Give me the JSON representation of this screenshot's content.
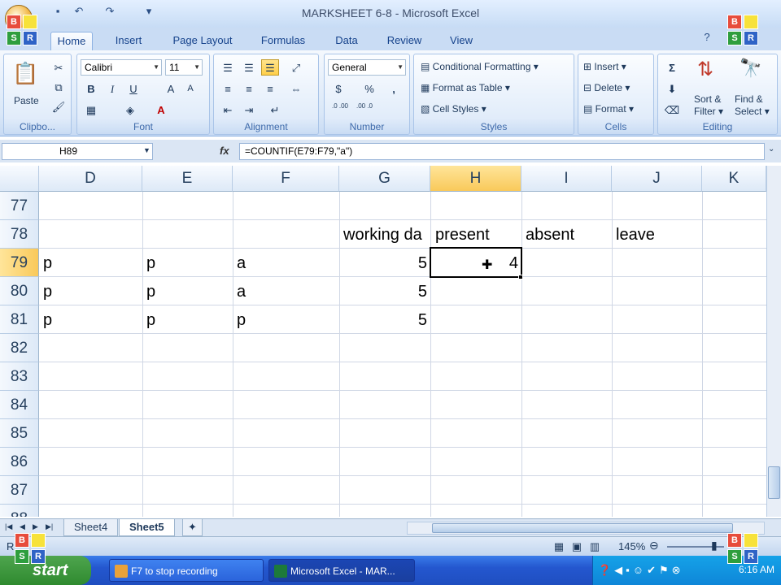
{
  "window": {
    "title": "MARKSHEET 6-8 - Microsoft Excel"
  },
  "tabs": [
    "Home",
    "Insert",
    "Page Layout",
    "Formulas",
    "Data",
    "Review",
    "View"
  ],
  "ribbon": {
    "clipboard": {
      "paste": "Paste",
      "label": "Clipbo..."
    },
    "font": {
      "name": "Calibri",
      "size": "11",
      "bold": "B",
      "italic": "I",
      "underline": "U",
      "grow": "A",
      "shrink": "A",
      "color": "A",
      "label": "Font"
    },
    "alignment": {
      "label": "Alignment"
    },
    "number": {
      "format": "General",
      "currency": "$",
      "percent": "%",
      "comma": ",",
      "inc_dec": ".0 .00",
      "dec_dec": ".00 .0",
      "label": "Number"
    },
    "styles": {
      "conditional": "Conditional Formatting",
      "format_table": "Format as Table",
      "cell_styles": "Cell Styles",
      "label": "Styles"
    },
    "cells": {
      "insert": "Insert",
      "delete": "Delete",
      "format": "Format",
      "label": "Cells"
    },
    "editing": {
      "sum": "Σ",
      "sort": "Sort &",
      "filter": "Filter",
      "find": "Find &",
      "select": "Select",
      "label": "Editing"
    }
  },
  "formula_bar": {
    "name_box": "H89",
    "fx": "fx",
    "formula": "=COUNTIF(E79:F79,\"a\")"
  },
  "grid": {
    "columns": [
      "D",
      "E",
      "F",
      "G",
      "H",
      "I",
      "J",
      "K"
    ],
    "selected_column": "H",
    "rows": [
      "77",
      "78",
      "79",
      "80",
      "81",
      "82",
      "83",
      "84",
      "85",
      "86",
      "87"
    ],
    "selected_row": "79",
    "partial_row": "88",
    "cells": {
      "G78": "working da",
      "H78": "present",
      "I78": "absent",
      "J78": "leave",
      "D79": "p",
      "E79": "p",
      "F79": "a",
      "G79": "5",
      "H79": "4",
      "D80": "p",
      "E80": "p",
      "F80": "a",
      "G80": "5",
      "D81": "p",
      "E81": "p",
      "F81": "p",
      "G81": "5"
    }
  },
  "sheets": [
    "Sheet4",
    "Sheet5"
  ],
  "active_sheet": "Sheet5",
  "status": {
    "mode": "R",
    "zoom": "145%"
  },
  "taskbar": {
    "start": "start",
    "tasks": [
      "F7 to stop recording",
      "Microsoft Excel - MAR..."
    ],
    "clock": "6:16 AM"
  },
  "logo": {
    "letters": [
      "B",
      "",
      "S",
      "R"
    ]
  },
  "colors": {
    "ribbon": "#dbe7f7",
    "selected_header": "#f9c95a",
    "taskbar": "#2457cf",
    "start": "#2f8a2f"
  }
}
